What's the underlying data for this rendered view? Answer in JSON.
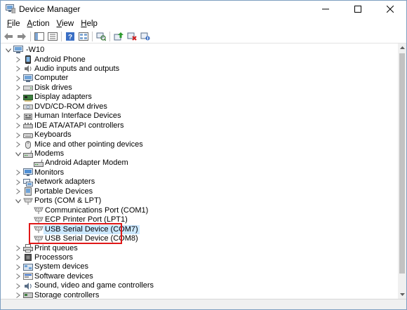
{
  "window": {
    "title": "Device Manager",
    "minimize_glyph": "—",
    "maximize_glyph": "☐",
    "close_glyph": "✕"
  },
  "menu": {
    "items": [
      {
        "label": "File",
        "name": "menu-file"
      },
      {
        "label": "Action",
        "name": "menu-action"
      },
      {
        "label": "View",
        "name": "menu-view"
      },
      {
        "label": "Help",
        "name": "menu-help"
      }
    ]
  },
  "toolbar": {
    "buttons": [
      "back-icon",
      "forward-icon",
      "show-hide-console-tree-icon",
      "properties-icon",
      "help-icon",
      "view-icon",
      "update-driver-icon",
      "uninstall-device-icon",
      "scan-hardware-changes-icon"
    ]
  },
  "tree": {
    "root_label": "        -W10",
    "nodes": [
      {
        "label": "Android Phone",
        "icon": "phone-icon",
        "expanded": false
      },
      {
        "label": "Audio inputs and outputs",
        "icon": "audio-icon",
        "expanded": false
      },
      {
        "label": "Computer",
        "icon": "computer-icon",
        "expanded": false
      },
      {
        "label": "Disk drives",
        "icon": "disk-drive-icon",
        "expanded": false
      },
      {
        "label": "Display adapters",
        "icon": "display-adapter-icon",
        "expanded": false
      },
      {
        "label": "DVD/CD-ROM drives",
        "icon": "dvd-drive-icon",
        "expanded": false
      },
      {
        "label": "Human Interface Devices",
        "icon": "hid-icon",
        "expanded": false
      },
      {
        "label": "IDE ATA/ATAPI controllers",
        "icon": "ide-controller-icon",
        "expanded": false
      },
      {
        "label": "Keyboards",
        "icon": "keyboard-icon",
        "expanded": false
      },
      {
        "label": "Mice and other pointing devices",
        "icon": "mouse-icon",
        "expanded": false
      },
      {
        "label": "Modems",
        "icon": "modem-icon",
        "expanded": true
      },
      {
        "label": "Android Adapter Modem",
        "icon": "modem-icon",
        "child": true
      },
      {
        "label": "Monitors",
        "icon": "monitor-icon",
        "expanded": false
      },
      {
        "label": "Network adapters",
        "icon": "network-adapter-icon",
        "expanded": false
      },
      {
        "label": "Portable Devices",
        "icon": "portable-device-icon",
        "expanded": false
      },
      {
        "label": "Ports (COM & LPT)",
        "icon": "port-icon",
        "expanded": true
      },
      {
        "label": "Communications Port (COM1)",
        "icon": "port-icon",
        "child": true
      },
      {
        "label": "ECP Printer Port (LPT1)",
        "icon": "port-icon",
        "child": true
      },
      {
        "label": "USB Serial Device (COM7)",
        "icon": "port-icon",
        "child": true,
        "selected": true
      },
      {
        "label": "USB Serial Device (COM8)",
        "icon": "port-icon",
        "child": true
      },
      {
        "label": "Print queues",
        "icon": "printer-icon",
        "expanded": false
      },
      {
        "label": "Processors",
        "icon": "processor-icon",
        "expanded": false
      },
      {
        "label": "System devices",
        "icon": "system-device-icon",
        "expanded": false
      },
      {
        "label": "Software devices",
        "icon": "software-device-icon",
        "expanded": false
      },
      {
        "label": "Sound, video and game controllers",
        "icon": "sound-icon",
        "expanded": false
      },
      {
        "label": "Storage controllers",
        "icon": "storage-controller-icon",
        "expanded": false
      }
    ]
  },
  "colors": {
    "selection": "#cce8ff",
    "highlight_box": "#e01818",
    "window_border": "#7d9ec0"
  }
}
